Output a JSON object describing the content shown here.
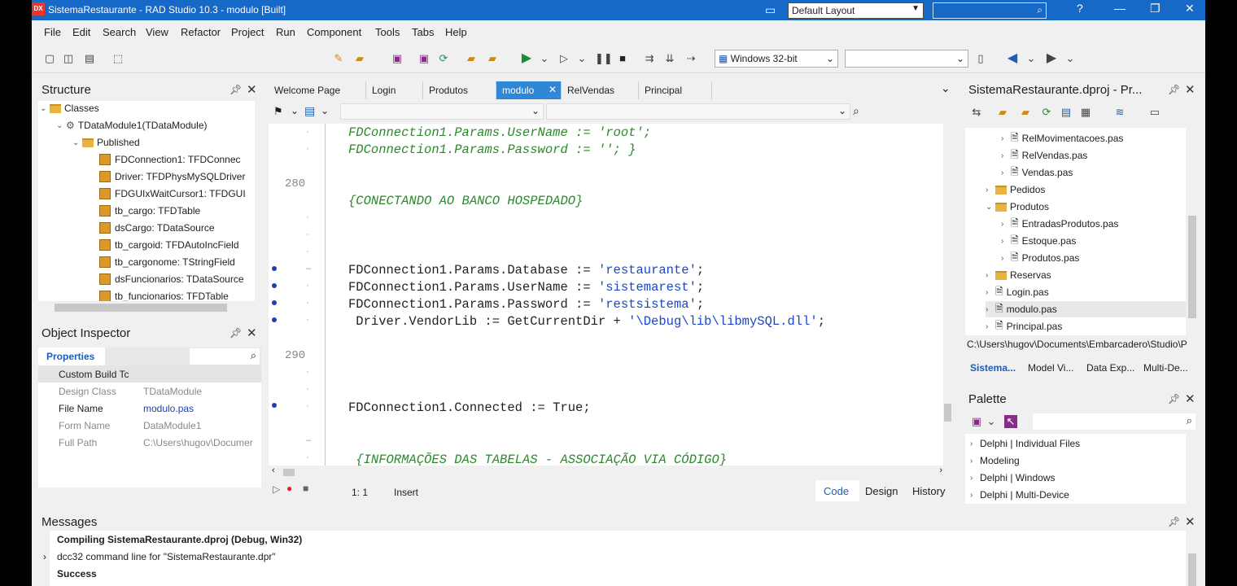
{
  "title": {
    "text": "SistemaRestaurante - RAD Studio 10.3 - modulo [Built]",
    "logo": "DX",
    "layout_value": "Default Layout"
  },
  "menu": [
    "File",
    "Edit",
    "Search",
    "View",
    "Refactor",
    "Project",
    "Run",
    "Component",
    "Tools",
    "Tabs",
    "Help"
  ],
  "toolbar": {
    "platform": "Windows 32-bit"
  },
  "structure": {
    "title": "Structure",
    "items": [
      {
        "label": "Classes"
      },
      {
        "label": "TDataModule1(TDataModule)"
      },
      {
        "label": "Published"
      },
      {
        "label": "FDConnection1: TFDConnec"
      },
      {
        "label": "Driver: TFDPhysMySQLDriver"
      },
      {
        "label": "FDGUIxWaitCursor1: TFDGUI"
      },
      {
        "label": "tb_cargo: TFDTable"
      },
      {
        "label": "dsCargo: TDataSource"
      },
      {
        "label": "tb_cargoid: TFDAutoIncField"
      },
      {
        "label": "tb_cargonome: TStringField"
      },
      {
        "label": "dsFuncionarios: TDataSource"
      },
      {
        "label": "tb_funcionarios: TFDTable"
      }
    ]
  },
  "inspector": {
    "title": "Object Inspector",
    "tab": "Properties",
    "rows": [
      {
        "k": "Custom Build Tc",
        "v": ""
      },
      {
        "k": "Design Class",
        "v": "TDataModule"
      },
      {
        "k": "File Name",
        "v": "modulo.pas"
      },
      {
        "k": "Form Name",
        "v": "DataModule1"
      },
      {
        "k": "Full Path",
        "v": "C:\\Users\\hugov\\Documer"
      }
    ]
  },
  "tabs": [
    "Welcome Page",
    "Login",
    "Produtos",
    "modulo",
    "RelVendas",
    "Principal"
  ],
  "editor": {
    "line_280": "280",
    "line_290": "290",
    "lines": [
      "FDConnection1.Params.UserName := 'root';",
      "FDConnection1.Params.Password := ''; }",
      "{CONECTANDO AO BANCO HOSPEDADO}",
      "FDConnection1.Params.Database := ",
      "'restaurante'",
      ";",
      "FDConnection1.Params.UserName := ",
      "'sistemarest'",
      "FDConnection1.Params.Password := ",
      "'restsistema'",
      " Driver.VendorLib := GetCurrentDir + ",
      "'\\Debug\\lib\\libmySQL.dll'",
      "FDConnection1.Connected := True;",
      " {INFORMAÇÕES DAS TABELAS - ASSOCIAÇÃO VIA CÓDIGO}"
    ]
  },
  "status": {
    "pos": "1:  1",
    "mode": "Insert",
    "tabs": [
      "Code",
      "Design",
      "History"
    ]
  },
  "project": {
    "title": "SistemaRestaurante.dproj - Pr...",
    "items": [
      {
        "label": "RelMovimentacoes.pas"
      },
      {
        "label": "RelVendas.pas"
      },
      {
        "label": "Vendas.pas"
      },
      {
        "label": "Pedidos"
      },
      {
        "label": "Produtos"
      },
      {
        "label": "EntradasProdutos.pas"
      },
      {
        "label": "Estoque.pas"
      },
      {
        "label": "Produtos.pas"
      },
      {
        "label": "Reservas"
      },
      {
        "label": "Login.pas"
      },
      {
        "label": "modulo.pas"
      },
      {
        "label": "Principal.pas"
      }
    ],
    "path": "C:\\Users\\hugov\\Documents\\Embarcadero\\Studio\\P",
    "tabs": [
      "Sistema...",
      "Model Vi...",
      "Data Exp...",
      "Multi-De..."
    ]
  },
  "palette": {
    "title": "Palette",
    "items": [
      "Delphi | Individual Files",
      "Modeling",
      "Delphi | Windows",
      "Delphi | Multi-Device"
    ]
  },
  "messages": {
    "title": "Messages",
    "lines": [
      "Compiling SistemaRestaurante.dproj (Debug, Win32)",
      "dcc32 command line for \"SistemaRestaurante.dpr\"",
      "Success"
    ]
  }
}
